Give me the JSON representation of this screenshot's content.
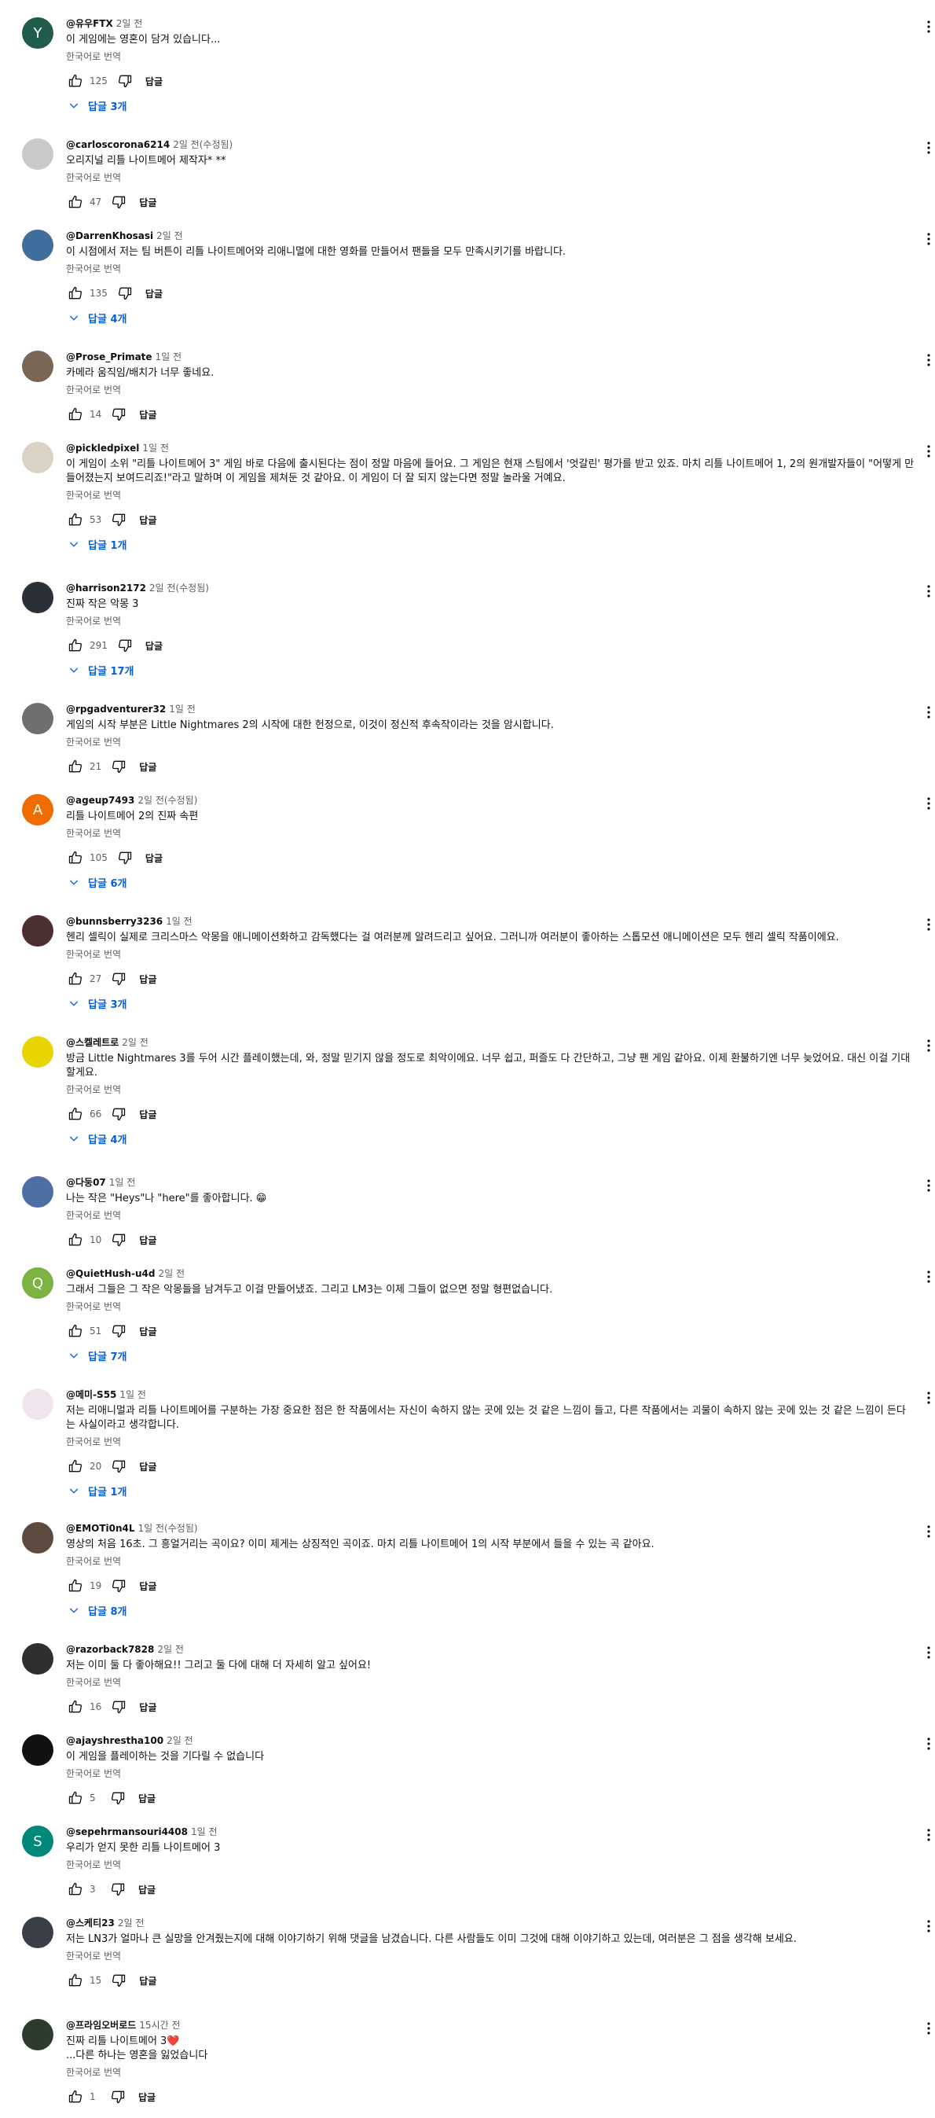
{
  "translate_label": "한국어로 번역",
  "reply_label": "답글",
  "colors": {
    "link": "#065fd4",
    "meta": "#606060",
    "text": "#0f0f0f"
  },
  "icons": {
    "like": "thumbs-up-icon",
    "dislike": "thumbs-down-icon",
    "replies": "chevron-down-icon",
    "more": "more-vert-icon"
  },
  "comments": [
    {
      "author": "@유우FTX",
      "time": "2일 전",
      "text": "이 게임에는 영혼이 담겨 있습니다...",
      "likes": "125",
      "replies": "답글 3개",
      "avatar_letter": "Y",
      "avatar_color": "#1f5c4b"
    },
    {
      "author": "@carloscorona6214",
      "time": "2일 전(수정됨)",
      "text": "오리지널 리틀 나이트메어 제작자* **",
      "likes": "47",
      "replies": "",
      "avatar_letter": "",
      "avatar_color": "#c9c9c9"
    },
    {
      "author": "@DarrenKhosasi",
      "time": "2일 전",
      "text": "이 시점에서 저는 팀 버튼이 리틀 나이트메어와 리애니멀에 대한 영화를 만들어서 팬들을 모두 만족시키기를 바랍니다.",
      "likes": "135",
      "replies": "답글 4개",
      "avatar_letter": "",
      "avatar_color": "#3f6e9c"
    },
    {
      "author": "@Prose_Primate",
      "time": "1일 전",
      "text": "카메라 움직임/배치가 너무 좋네요.",
      "likes": "14",
      "replies": "",
      "avatar_letter": "",
      "avatar_color": "#7a6654"
    },
    {
      "author": "@pickledpixel",
      "time": "1일 전",
      "text": "이 게임이 소위 \"리틀 나이트메어 3\" 게임 바로 다음에 출시된다는 점이 정말 마음에 들어요. 그 게임은 현재 스팀에서 '엇갈린' 평가를 받고 있죠. 마치 리틀 나이트메어 1, 2의 원개발자들이 \"어떻게 만들어졌는지 보여드리죠!\"라고 말하며 이 게임을 제쳐둔 것 같아요. 이 게임이 더 잘 되지 않는다면 정말 놀라울 거예요.",
      "likes": "53",
      "replies": "답글 1개",
      "avatar_letter": "",
      "avatar_color": "#d9d2c5"
    },
    {
      "author": "@harrison2172",
      "time": "2일 전(수정됨)",
      "text": "진짜 작은 악몽 3",
      "likes": "291",
      "replies": "답글 17개",
      "avatar_letter": "",
      "avatar_color": "#2b2f38"
    },
    {
      "author": "@rpgadventurer32",
      "time": "1일 전",
      "text": "게임의 시작 부분은 Little Nightmares 2의 시작에 대한 헌정으로, 이것이 정신적 후속작이라는 것을 암시합니다.",
      "likes": "21",
      "replies": "",
      "avatar_letter": "",
      "avatar_color": "#6f6f6f"
    },
    {
      "author": "@ageup7493",
      "time": "2일 전(수정됨)",
      "text": "리틀 나이트메어 2의 진짜 속편",
      "likes": "105",
      "replies": "답글 6개",
      "avatar_letter": "A",
      "avatar_color": "#ef6c00"
    },
    {
      "author": "@bunnsberry3236",
      "time": "1일 전",
      "text": "헨리 셀릭이 실제로 크리스마스 악몽을 애니메이션화하고 감독했다는 걸 여러분께 알려드리고 싶어요. 그러니까 여러분이 좋아하는 스톱모션 애니메이션은 모두 헨리 셀릭 작품이에요.",
      "likes": "27",
      "replies": "답글 3개",
      "avatar_letter": "",
      "avatar_color": "#4a3030"
    },
    {
      "author": "@스켈레트로",
      "time": "2일 전",
      "text": "방금 Little Nightmares 3를 두어 시간 플레이했는데, 와, 정말 믿기지 않을 정도로 최악이에요. 너무 쉽고, 퍼즐도 다 간단하고, 그냥 팬 게임 같아요. 이제 환불하기엔 너무 늦었어요. 대신 이걸 기대할게요.",
      "likes": "66",
      "replies": "답글 4개",
      "avatar_letter": "",
      "avatar_color": "#e8d400"
    },
    {
      "author": "@다둥07",
      "time": "1일 전",
      "text": "나는 작은 \"Heys\"나 \"here\"를 좋아합니다. 😁",
      "likes": "10",
      "replies": "",
      "avatar_letter": "",
      "avatar_color": "#4d6fa3"
    },
    {
      "author": "@QuietHush-u4d",
      "time": "2일 전",
      "text": "그래서 그들은 그 작은 악몽들을 남겨두고 이걸 만들어냈죠. 그리고 LM3는 이제 그들이 없으면 정말 형편없습니다.",
      "likes": "51",
      "replies": "답글 7개",
      "avatar_letter": "Q",
      "avatar_color": "#7cb342"
    },
    {
      "author": "@메미-S55",
      "time": "1일 전",
      "text": "저는 리애니멀과 리틀 나이트메어를 구분하는 가장 중요한 점은 한 작품에서는 자신이 속하지 않는 곳에 있는 것 같은 느낌이 들고, 다른 작품에서는 괴물이 속하지 않는 곳에 있는 것 같은 느낌이 든다는 사실이라고 생각합니다.",
      "likes": "20",
      "replies": "답글 1개",
      "avatar_letter": "",
      "avatar_color": "#f1e6ee"
    },
    {
      "author": "@EMOTi0n4L",
      "time": "1일 전(수정됨)",
      "text": "영상의 처음 16초. 그 흥얼거리는 곡이요? 이미 제게는 상징적인 곡이죠. 마치 리틀 나이트메어 1의 시작 부분에서 들을 수 있는 곡 같아요.",
      "likes": "19",
      "replies": "답글 8개",
      "avatar_letter": "",
      "avatar_color": "#5b4a3d"
    },
    {
      "author": "@razorback7828",
      "time": "2일 전",
      "text": "저는 이미 둘 다 좋아해요!! 그리고 둘 다에 대해 더 자세히 알고 싶어요!",
      "likes": "16",
      "replies": "",
      "avatar_letter": "",
      "avatar_color": "#2f2f2f"
    },
    {
      "author": "@ajayshrestha100",
      "time": "2일 전",
      "text": "이 게임을 플레이하는 것을 기다릴 수 없습니다",
      "likes": "5",
      "replies": "",
      "avatar_letter": "",
      "avatar_color": "#111111"
    },
    {
      "author": "@sepehrmansouri4408",
      "time": "1일 전",
      "text": "우리가 얻지 못한 리틀 나이트메어 3",
      "likes": "3",
      "replies": "",
      "avatar_letter": "S",
      "avatar_color": "#00897b"
    },
    {
      "author": "@스케티23",
      "time": "2일 전",
      "text": "저는 LN3가 얼마나 큰 실망을 안겨줬는지에 대해 이야기하기 위해 댓글을 남겼습니다. 다른 사람들도 이미 그것에 대해 이야기하고 있는데, 여러분은 그 점을 생각해 보세요.",
      "likes": "15",
      "replies": "",
      "avatar_letter": "",
      "avatar_color": "#3a3f47"
    },
    {
      "author": "@프라임오버로드",
      "time": "15시간 전",
      "text": "진짜 리틀 나이트메어 3❤️\n...다른 하나는 영혼을 잃었습니다",
      "likes": "1",
      "replies": "",
      "avatar_letter": "",
      "avatar_color": "#2d3a2e"
    }
  ]
}
